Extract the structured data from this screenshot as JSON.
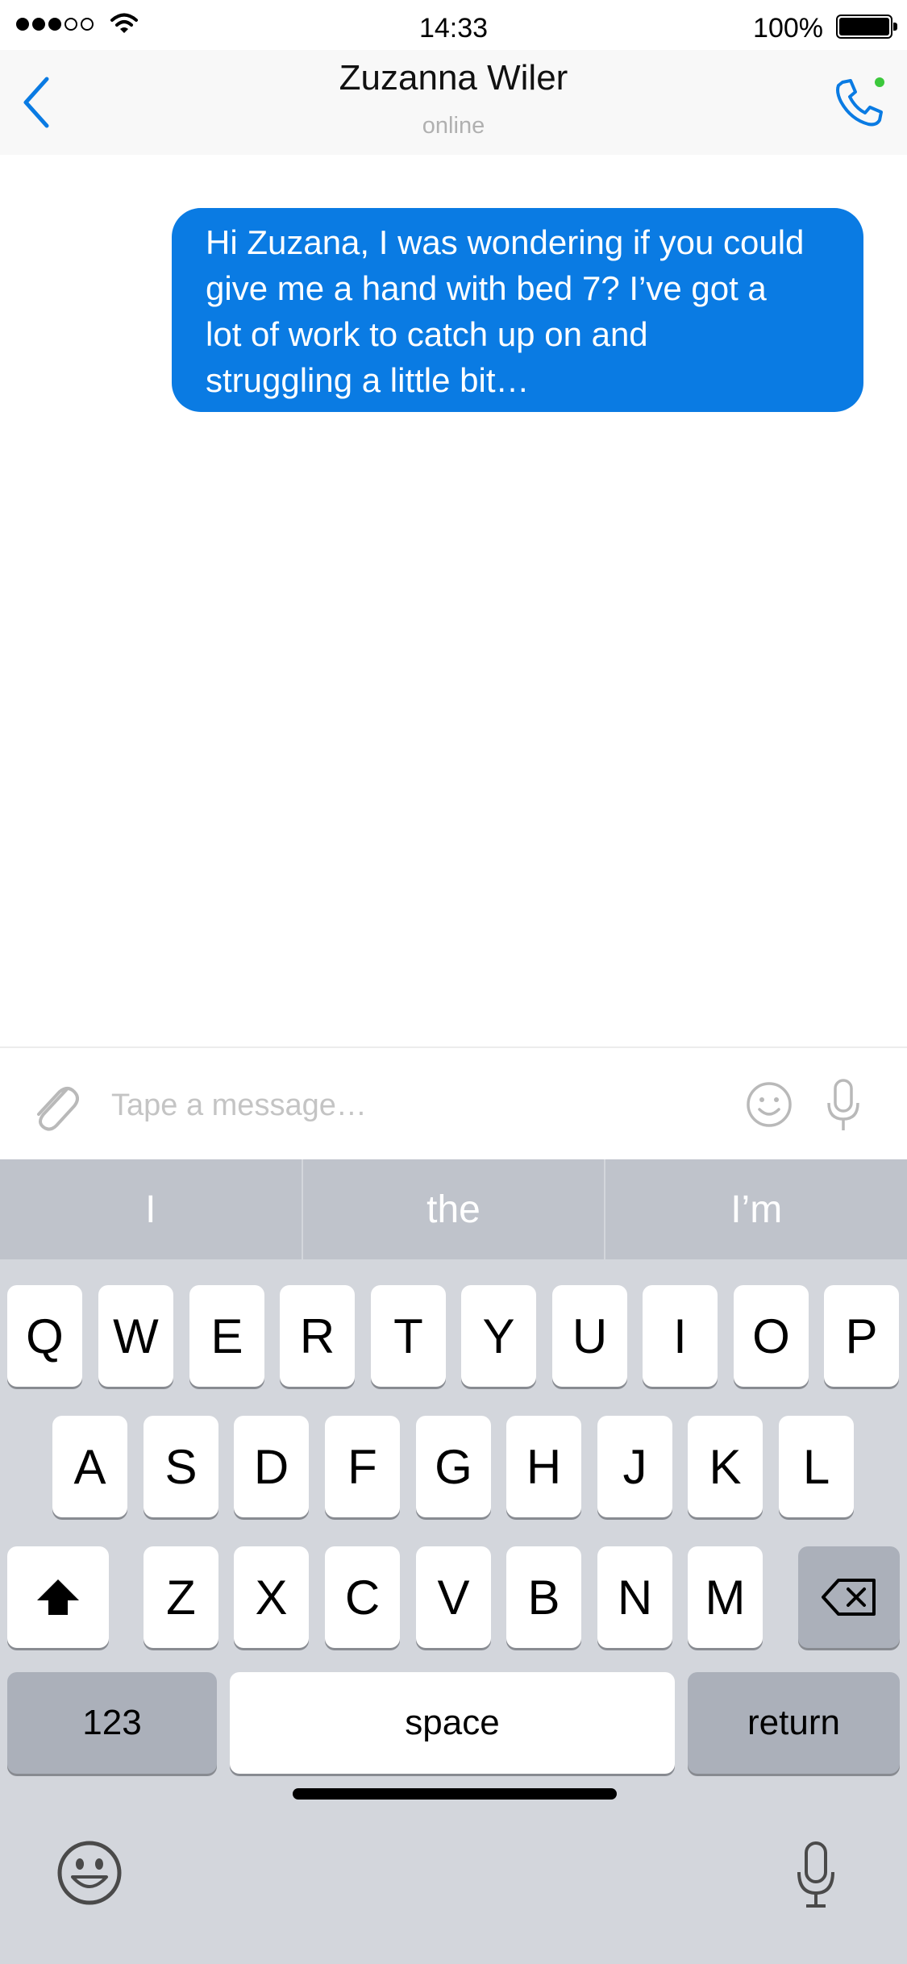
{
  "status_bar": {
    "time": "14:33",
    "battery_percent": "100%",
    "signal_bars_filled": 3,
    "signal_bars_total": 5
  },
  "header": {
    "contact_name": "Zuzanna Wiler",
    "contact_status": "online",
    "back_icon": "chevron-left-icon",
    "call_icon": "phone-icon",
    "presence_color": "#3cc83c"
  },
  "messages": [
    {
      "direction": "outgoing",
      "lines": [
        "Hi Zuzana, I was wondering if you could",
        "give me a hand with bed 7? I’ve got a",
        "lot of work to catch up on and",
        "struggling a little bit…"
      ]
    }
  ],
  "composer": {
    "placeholder": "Tape a message…",
    "value": "",
    "attach_icon": "paperclip-icon",
    "emoji_icon": "smiley-icon",
    "mic_icon": "microphone-icon"
  },
  "keyboard": {
    "suggestions": [
      "I",
      "the",
      "I’m"
    ],
    "row1": [
      "Q",
      "W",
      "E",
      "R",
      "T",
      "Y",
      "U",
      "I",
      "O",
      "P"
    ],
    "row2": [
      "A",
      "S",
      "D",
      "F",
      "G",
      "H",
      "J",
      "K",
      "L"
    ],
    "row3": [
      "Z",
      "X",
      "C",
      "V",
      "B",
      "N",
      "M"
    ],
    "numbers_label": "123",
    "space_label": "space",
    "return_label": "return"
  },
  "colors": {
    "accent": "#0a7be3",
    "keyboard_bg": "#d3d6dc",
    "suggestion_bar_bg": "#bfc3cb"
  }
}
